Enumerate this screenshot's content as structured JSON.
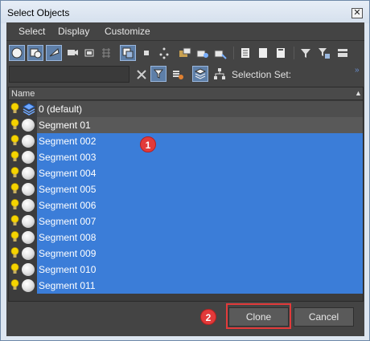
{
  "window": {
    "title": "Select Objects",
    "close_glyph": "✕"
  },
  "menu": {
    "items": [
      "Select",
      "Display",
      "Customize"
    ]
  },
  "filter": {
    "search_value": "",
    "selection_set_label": "Selection Set:",
    "more_glyph": "»"
  },
  "list": {
    "header": "Name",
    "sort_glyph": "▲",
    "rows": [
      {
        "label": "0 (default)",
        "kind": "layer",
        "state": "plain"
      },
      {
        "label": "Segment 01",
        "kind": "object",
        "state": "current"
      },
      {
        "label": "Segment 002",
        "kind": "object",
        "state": "selected"
      },
      {
        "label": "Segment 003",
        "kind": "object",
        "state": "selected"
      },
      {
        "label": "Segment 004",
        "kind": "object",
        "state": "selected"
      },
      {
        "label": "Segment 005",
        "kind": "object",
        "state": "selected"
      },
      {
        "label": "Segment 006",
        "kind": "object",
        "state": "selected"
      },
      {
        "label": "Segment 007",
        "kind": "object",
        "state": "selected"
      },
      {
        "label": "Segment 008",
        "kind": "object",
        "state": "selected"
      },
      {
        "label": "Segment 009",
        "kind": "object",
        "state": "selected"
      },
      {
        "label": "Segment 010",
        "kind": "object",
        "state": "selected"
      },
      {
        "label": "Segment 011",
        "kind": "object",
        "state": "selected"
      }
    ]
  },
  "markers": {
    "one": "1",
    "two": "2"
  },
  "buttons": {
    "clone": "Clone",
    "cancel": "Cancel"
  },
  "colors": {
    "selection": "#3b7dd8",
    "panel": "#444444",
    "marker": "#e23a3a"
  },
  "icons": {
    "toolbar": [
      "display-geometry-icon",
      "display-shapes-icon",
      "display-lights-icon",
      "display-cameras-icon",
      "display-helpers-icon",
      "display-spacewarps-icon",
      "display-groups-icon",
      "display-xrefs-icon",
      "display-bones-icon",
      "display-containers-icon",
      "display-frozen-icon",
      "display-hidden-icon",
      "display-all-icon",
      "select-all-icon",
      "select-none-icon",
      "select-invert-icon",
      "filter-icon",
      "filter-selected-icon",
      "collapse-icon"
    ]
  }
}
